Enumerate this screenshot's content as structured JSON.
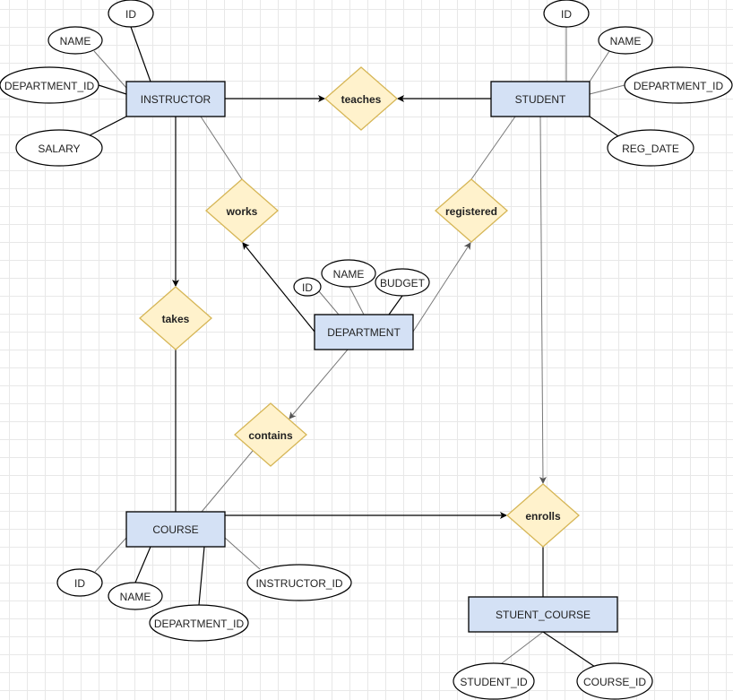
{
  "entities": {
    "instructor": "INSTRUCTOR",
    "student": "STUDENT",
    "department": "DEPARTMENT",
    "course": "COURSE",
    "student_course": "STUENT_COURSE"
  },
  "relationships": {
    "teaches": "teaches",
    "works": "works",
    "registered": "registered",
    "takes": "takes",
    "contains": "contains",
    "enrolls": "enrolls"
  },
  "attributes": {
    "instructor": [
      "ID",
      "NAME",
      "DEPARTMENT_ID",
      "SALARY"
    ],
    "student": [
      "ID",
      "NAME",
      "DEPARTMENT_ID",
      "REG_DATE"
    ],
    "department": [
      "ID",
      "NAME",
      "BUDGET"
    ],
    "course": [
      "ID",
      "NAME",
      "DEPARTMENT_ID",
      "INSTRUCTOR_ID"
    ],
    "student_course": [
      "STUDENT_ID",
      "COURSE_ID"
    ]
  },
  "colors": {
    "entity_fill": "#d4e1f5",
    "relationship_fill": "#fff2cc",
    "relationship_stroke": "#d6b656"
  }
}
